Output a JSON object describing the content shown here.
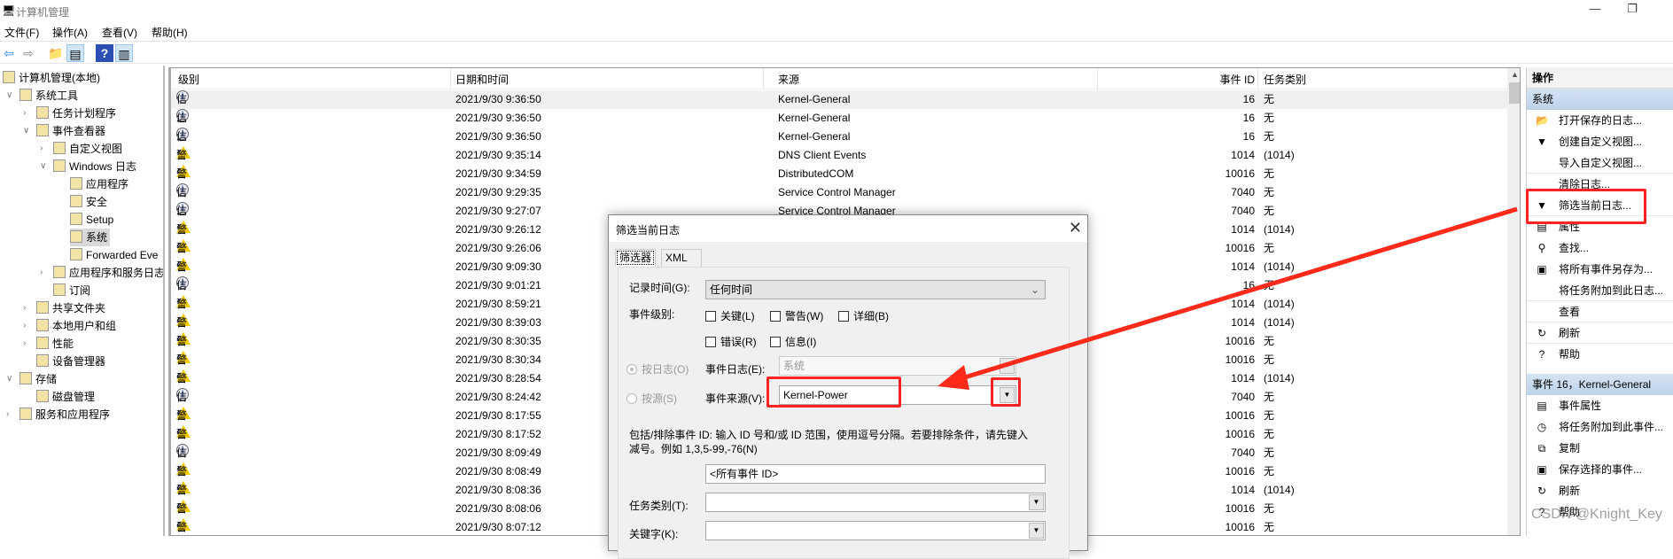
{
  "window": {
    "title": "计算机管理",
    "minimize_label": "—",
    "restore_label": "❐"
  },
  "menu": [
    "文件(F)",
    "操作(A)",
    "查看(V)",
    "帮助(H)"
  ],
  "toolbar": {
    "icons": [
      "back-arrow-icon",
      "forward-arrow-icon",
      "up-folder-icon",
      "show-hide-tree-icon",
      "help-icon",
      "show-hide-action-pane-icon"
    ],
    "glyphs": [
      "⇦",
      "⇨",
      "📁",
      "▤",
      "?",
      "▥"
    ]
  },
  "tree": [
    {
      "label": "计算机管理(本地)",
      "level": 0,
      "chevron": ""
    },
    {
      "label": "系统工具",
      "level": 1,
      "chevron": "∨"
    },
    {
      "label": "任务计划程序",
      "level": 2,
      "chevron": "›"
    },
    {
      "label": "事件查看器",
      "level": 2,
      "chevron": "∨"
    },
    {
      "label": "自定义视图",
      "level": 3,
      "chevron": "›"
    },
    {
      "label": "Windows 日志",
      "level": 3,
      "chevron": "∨"
    },
    {
      "label": "应用程序",
      "level": 4,
      "chevron": ""
    },
    {
      "label": "安全",
      "level": 4,
      "chevron": ""
    },
    {
      "label": "Setup",
      "level": 4,
      "chevron": ""
    },
    {
      "label": "系统",
      "level": 4,
      "chevron": "",
      "selected": true
    },
    {
      "label": "Forwarded Eve",
      "level": 4,
      "chevron": ""
    },
    {
      "label": "应用程序和服务日志",
      "level": 3,
      "chevron": "›"
    },
    {
      "label": "订阅",
      "level": 3,
      "chevron": ""
    },
    {
      "label": "共享文件夹",
      "level": 2,
      "chevron": "›"
    },
    {
      "label": "本地用户和组",
      "level": 2,
      "chevron": "›"
    },
    {
      "label": "性能",
      "level": 2,
      "chevron": "›"
    },
    {
      "label": "设备管理器",
      "level": 2,
      "chevron": ""
    },
    {
      "label": "存储",
      "level": 1,
      "chevron": "∨"
    },
    {
      "label": "磁盘管理",
      "level": 2,
      "chevron": ""
    },
    {
      "label": "服务和应用程序",
      "level": 1,
      "chevron": "›"
    }
  ],
  "table": {
    "columns": {
      "level": "级别",
      "datetime": "日期和时间",
      "source": "来源",
      "event_id": "事件 ID",
      "task": "任务类别"
    },
    "rows": [
      {
        "level": "信息",
        "datetime": "2021/9/30 9:36:50",
        "source": "Kernel-General",
        "event_id": "16",
        "task": "无"
      },
      {
        "level": "信息",
        "datetime": "2021/9/30 9:36:50",
        "source": "Kernel-General",
        "event_id": "16",
        "task": "无"
      },
      {
        "level": "信息",
        "datetime": "2021/9/30 9:36:50",
        "source": "Kernel-General",
        "event_id": "16",
        "task": "无"
      },
      {
        "level": "警告",
        "datetime": "2021/9/30 9:35:14",
        "source": "DNS Client Events",
        "event_id": "1014",
        "task": "(1014)"
      },
      {
        "level": "警告",
        "datetime": "2021/9/30 9:34:59",
        "source": "DistributedCOM",
        "event_id": "10016",
        "task": "无"
      },
      {
        "level": "信息",
        "datetime": "2021/9/30 9:29:35",
        "source": "Service Control Manager",
        "event_id": "7040",
        "task": "无"
      },
      {
        "level": "信息",
        "datetime": "2021/9/30 9:27:07",
        "source": "Service Control Manager",
        "event_id": "7040",
        "task": "无"
      },
      {
        "level": "警告",
        "datetime": "2021/9/30 9:26:12",
        "source": "",
        "event_id": "1014",
        "task": "(1014)"
      },
      {
        "level": "警告",
        "datetime": "2021/9/30 9:26:06",
        "source": "",
        "event_id": "10016",
        "task": "无"
      },
      {
        "level": "警告",
        "datetime": "2021/9/30 9:09:30",
        "source": "",
        "event_id": "1014",
        "task": "(1014)"
      },
      {
        "level": "信息",
        "datetime": "2021/9/30 9:01:21",
        "source": "",
        "event_id": "16",
        "task": "无"
      },
      {
        "level": "警告",
        "datetime": "2021/9/30 8:59:21",
        "source": "",
        "event_id": "1014",
        "task": "(1014)"
      },
      {
        "level": "警告",
        "datetime": "2021/9/30 8:39:03",
        "source": "",
        "event_id": "1014",
        "task": "(1014)"
      },
      {
        "level": "警告",
        "datetime": "2021/9/30 8:30:35",
        "source": "",
        "event_id": "10016",
        "task": "无"
      },
      {
        "level": "警告",
        "datetime": "2021/9/30 8:30:34",
        "source": "",
        "event_id": "10016",
        "task": "无"
      },
      {
        "level": "警告",
        "datetime": "2021/9/30 8:28:54",
        "source": "",
        "event_id": "1014",
        "task": "(1014)"
      },
      {
        "level": "信息",
        "datetime": "2021/9/30 8:24:42",
        "source": "",
        "event_id": "7040",
        "task": "无"
      },
      {
        "level": "警告",
        "datetime": "2021/9/30 8:17:55",
        "source": "",
        "event_id": "10016",
        "task": "无"
      },
      {
        "level": "警告",
        "datetime": "2021/9/30 8:17:52",
        "source": "",
        "event_id": "10016",
        "task": "无"
      },
      {
        "level": "信息",
        "datetime": "2021/9/30 8:09:49",
        "source": "",
        "event_id": "7040",
        "task": "无"
      },
      {
        "level": "警告",
        "datetime": "2021/9/30 8:08:49",
        "source": "",
        "event_id": "10016",
        "task": "无"
      },
      {
        "level": "警告",
        "datetime": "2021/9/30 8:08:36",
        "source": "",
        "event_id": "1014",
        "task": "(1014)"
      },
      {
        "level": "警告",
        "datetime": "2021/9/30 8:08:06",
        "source": "",
        "event_id": "10016",
        "task": "无"
      },
      {
        "level": "警告",
        "datetime": "2021/9/30 8:07:12",
        "source": "",
        "event_id": "10016",
        "task": "无"
      }
    ]
  },
  "actions": {
    "header": "操作",
    "section1": "系统",
    "items1": [
      {
        "label": "打开保存的日志...",
        "icon": "open-folder-icon",
        "glyph": "📂"
      },
      {
        "label": "创建自定义视图...",
        "icon": "filter-icon",
        "glyph": "▼"
      },
      {
        "label": "导入自定义视图...",
        "icon": "",
        "glyph": ""
      },
      {
        "label": "清除日志...",
        "icon": "",
        "glyph": ""
      },
      {
        "label": "筛选当前日志...",
        "icon": "filter-icon",
        "glyph": "▼"
      },
      {
        "label": "属性",
        "icon": "properties-icon",
        "glyph": "▤"
      },
      {
        "label": "查找...",
        "icon": "binoculars-icon",
        "glyph": "⚲"
      },
      {
        "label": "将所有事件另存为...",
        "icon": "save-icon",
        "glyph": "▣"
      },
      {
        "label": "将任务附加到此日志...",
        "icon": "",
        "glyph": ""
      },
      {
        "label": "查看",
        "icon": "",
        "glyph": ""
      },
      {
        "label": "刷新",
        "icon": "refresh-icon",
        "glyph": "↻"
      },
      {
        "label": "帮助",
        "icon": "help-icon",
        "glyph": "?"
      }
    ],
    "section2": "事件 16，Kernel-General",
    "items2": [
      {
        "label": "事件属性",
        "icon": "properties-icon",
        "glyph": "▤"
      },
      {
        "label": "将任务附加到此事件...",
        "icon": "task-clock-icon",
        "glyph": "◷"
      },
      {
        "label": "复制",
        "icon": "copy-icon",
        "glyph": "⧉"
      },
      {
        "label": "保存选择的事件...",
        "icon": "save-icon",
        "glyph": "▣"
      },
      {
        "label": "刷新",
        "icon": "refresh-icon",
        "glyph": "↻"
      },
      {
        "label": "帮助",
        "icon": "help-icon",
        "glyph": "?"
      }
    ]
  },
  "dialog": {
    "title": "筛选当前日志",
    "close": "✕",
    "tabs": [
      "筛选器",
      "XML"
    ],
    "logged_label": "记录时间(G):",
    "logged_value": "任何时间",
    "level_label": "事件级别:",
    "levels": [
      {
        "label": "关键(L)",
        "checked": false
      },
      {
        "label": "警告(W)",
        "checked": false
      },
      {
        "label": "详细(B)",
        "checked": false
      },
      {
        "label": "错误(R)",
        "checked": false
      },
      {
        "label": "信息(I)",
        "checked": false
      }
    ],
    "by_log_label": "按日志(O)",
    "by_source_label": "按源(S)",
    "event_log_label": "事件日志(E):",
    "event_log_value": "系统",
    "event_source_label": "事件来源(V):",
    "event_source_value": "Kernel-Power",
    "description": "包括/排除事件 ID: 输入 ID 号和/或 ID 范围，使用逗号分隔。若要排除条件，请先键入",
    "description2": "减号。例如 1,3,5-99,-76(N)",
    "event_ids_value": "<所有事件 ID>",
    "task_category_label": "任务类别(T):",
    "task_category_value": "",
    "keywords_label": "关键字(K):",
    "keywords_value": ""
  },
  "annotation_color": "#ff2a1a",
  "watermark": "CSDN @Knight_Key"
}
